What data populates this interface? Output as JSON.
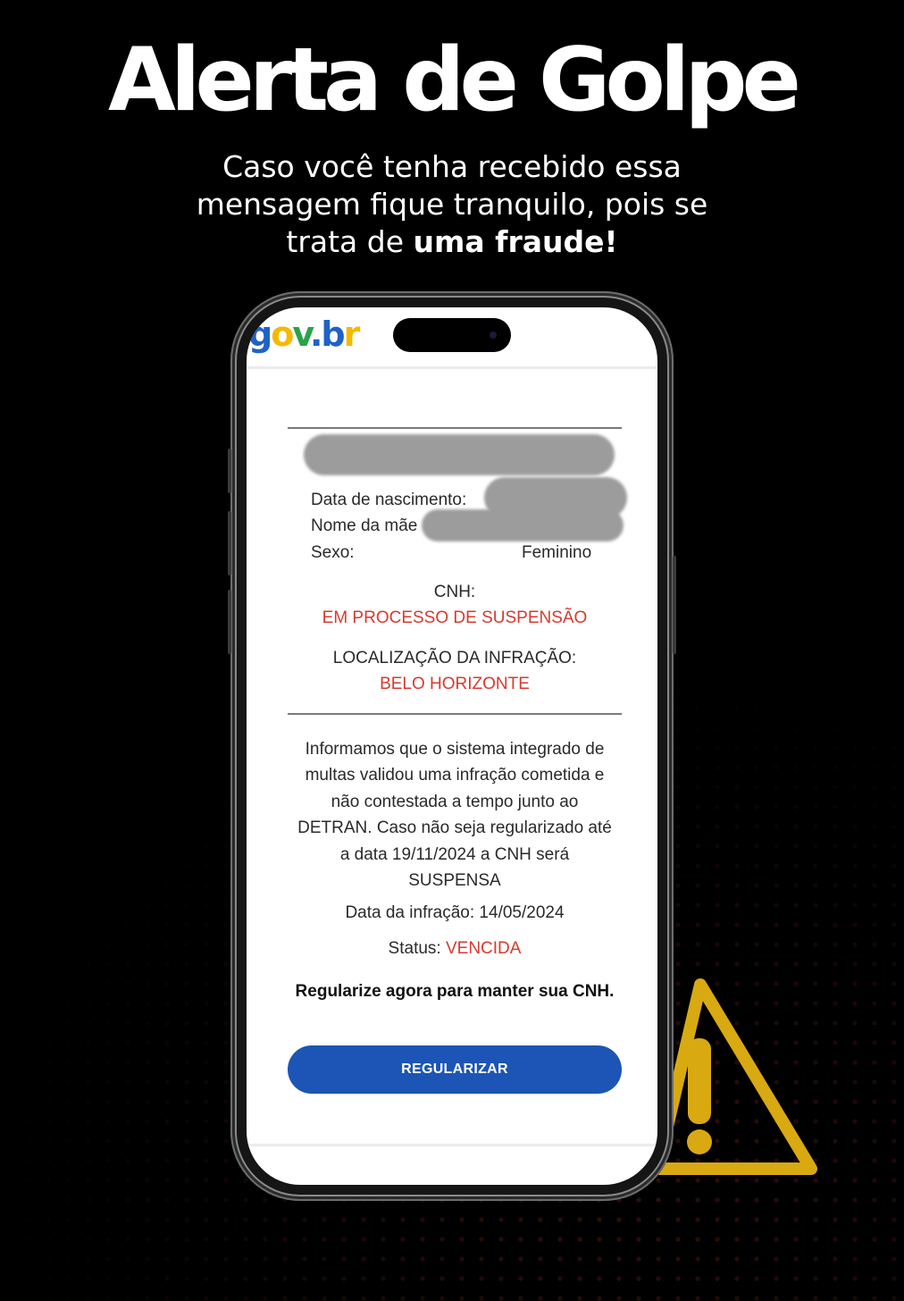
{
  "headline": "Alerta de Golpe",
  "subtitle": {
    "line1": "Caso você tenha recebido essa",
    "line2": "mensagem fique tranquilo, pois se",
    "line3_prefix": "trata de ",
    "line3_bold": "uma fraude!"
  },
  "colors": {
    "background": "#000000",
    "warning_yellow": "#d9a912",
    "alert_red": "#d63b2f",
    "button_blue": "#1c55b5"
  },
  "phone": {
    "logo": {
      "g": "g",
      "o": "o",
      "v": "v",
      "dot": ".",
      "b": "b",
      "r": "r"
    },
    "fields": {
      "birth_label": "Data de nascimento:",
      "mother_label": "Nome da mãe",
      "sex_label": "Sexo:",
      "sex_value": "Feminino"
    },
    "cnh_label": "CNH:",
    "cnh_status": "EM PROCESSO DE SUSPENSÃO",
    "location_label": "LOCALIZAÇÃO DA INFRAÇÃO:",
    "location_value": "BELO HORIZONTE",
    "message_lines": [
      "Informamos que o sistema integrado de",
      "multas validou uma infração cometida e",
      "não contestada a tempo junto ao",
      "DETRAN. Caso não seja regularizado até",
      "a data 19/11/2024 a CNH será",
      "SUSPENSA"
    ],
    "infraction_date": "Data da infração: 14/05/2024",
    "status_label": "Status: ",
    "status_value": "VENCIDA",
    "cta_text": "Regularize agora para manter sua CNH.",
    "button_label": "REGULARIZAR"
  },
  "icons": {
    "warning": "warning-triangle-icon"
  }
}
